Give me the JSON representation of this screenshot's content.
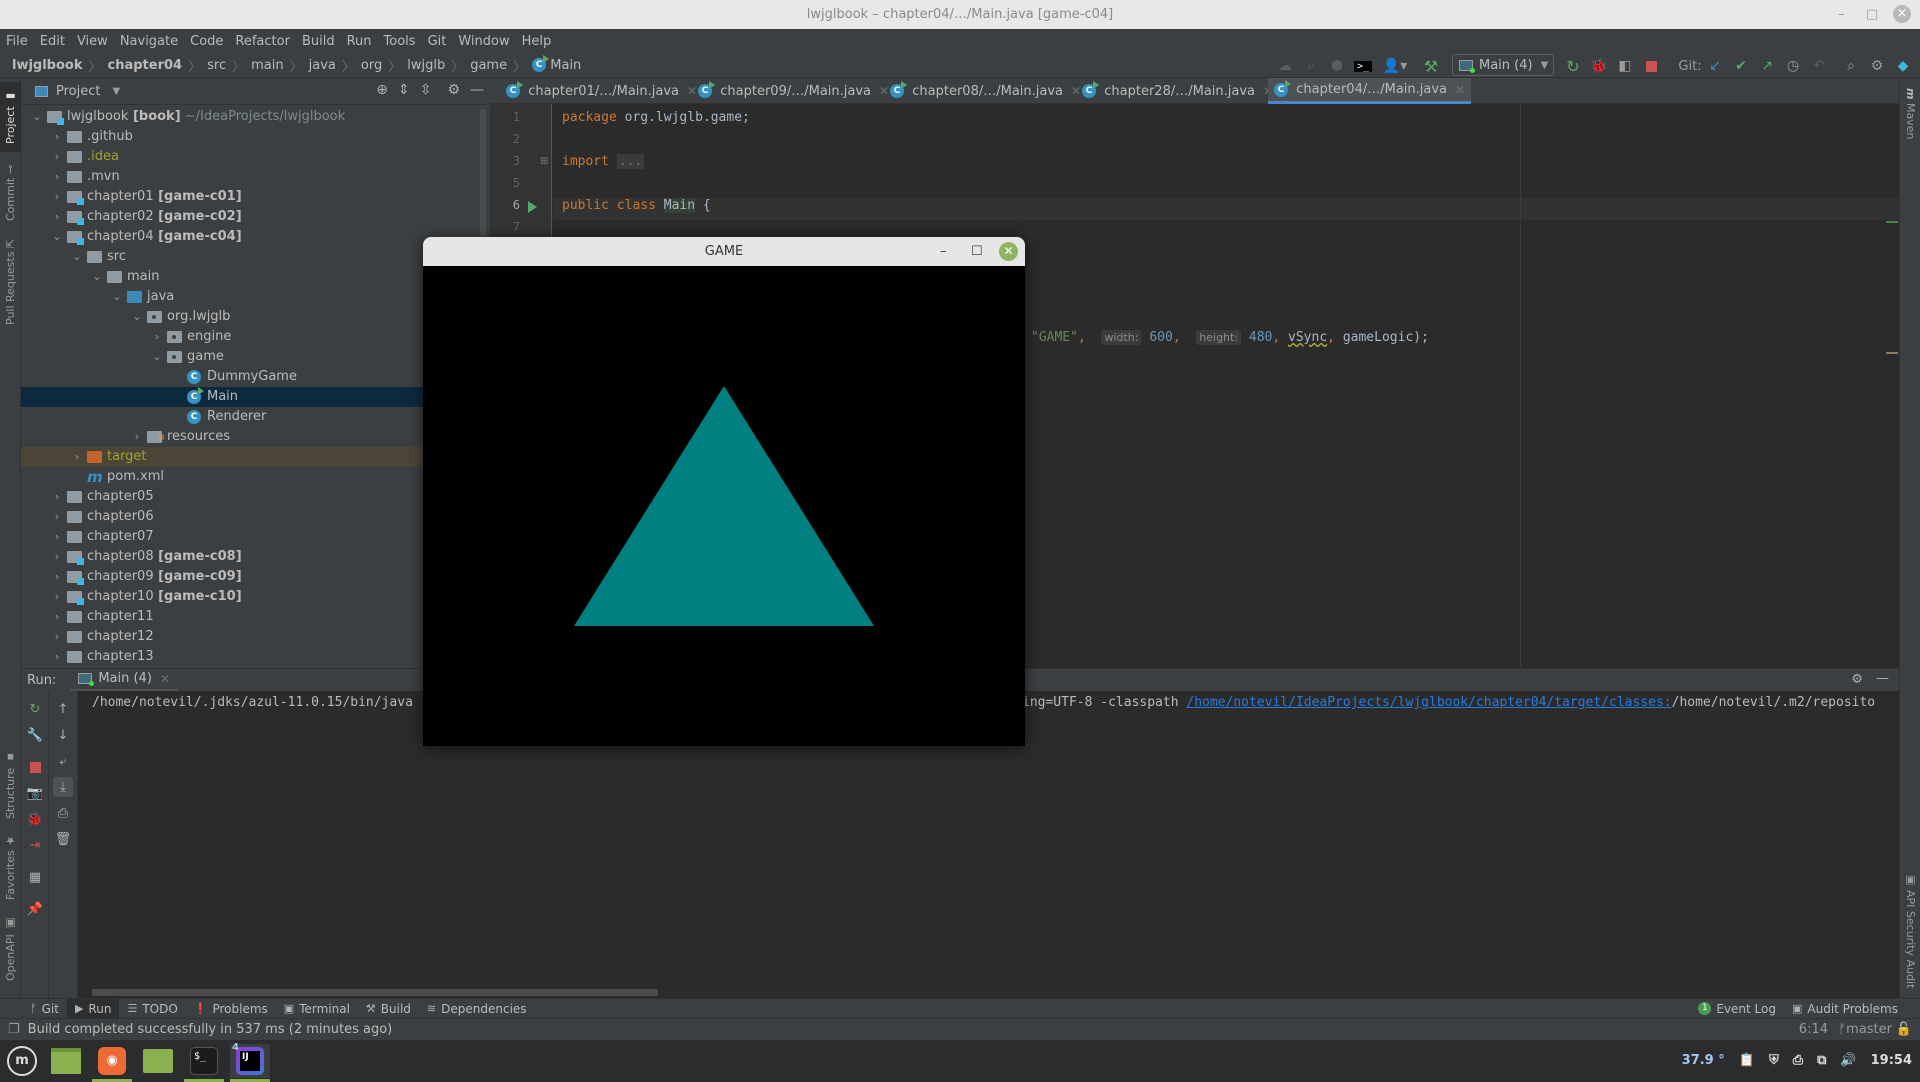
{
  "window": {
    "title": "lwjglbook – chapter04/…/Main.java [game-c04]",
    "minimize": "–",
    "maximize": "□",
    "close": "×"
  },
  "menu": [
    "File",
    "Edit",
    "View",
    "Navigate",
    "Code",
    "Refactor",
    "Build",
    "Run",
    "Tools",
    "Git",
    "Window",
    "Help"
  ],
  "breadcrumb": [
    "lwjglbook",
    "chapter04",
    "src",
    "main",
    "java",
    "org",
    "lwjglb",
    "game",
    "Main"
  ],
  "toolbar": {
    "run_config": "Main (4)",
    "git_label": "Git:",
    "icons": [
      "cloud-icon",
      "search-project-icon",
      "hexagon-icon",
      "terminal-icon",
      "user-dropdown-icon",
      "build-hammer-icon",
      "rerun-icon",
      "debug-icon",
      "coverage-icon",
      "stop-icon",
      "git-update-icon",
      "git-commit-icon",
      "git-push-icon",
      "history-icon",
      "rollback-icon",
      "search-icon",
      "settings-icon",
      "jetbrains-icon"
    ]
  },
  "left_strip": [
    "Project",
    "Commit",
    "Pull Requests",
    "Structure",
    "Favorites",
    "OpenAPI"
  ],
  "right_strip": [
    "Maven",
    "API Security Audit"
  ],
  "project": {
    "header": "Project",
    "tree": [
      {
        "label": "lwjglbook",
        "tag": "[book]",
        "path": "~/IdeaProjects/lwjglbook",
        "depth": 0,
        "expanded": true,
        "icon": "module"
      },
      {
        "label": ".github",
        "depth": 1,
        "expanded": false,
        "icon": "folder"
      },
      {
        "label": ".idea",
        "depth": 1,
        "expanded": false,
        "icon": "folder",
        "style": "olive"
      },
      {
        "label": ".mvn",
        "depth": 1,
        "expanded": false,
        "icon": "folder"
      },
      {
        "label": "chapter01",
        "tag": "[game-c01]",
        "depth": 1,
        "expanded": false,
        "icon": "module"
      },
      {
        "label": "chapter02",
        "tag": "[game-c02]",
        "depth": 1,
        "expanded": false,
        "icon": "module"
      },
      {
        "label": "chapter04",
        "tag": "[game-c04]",
        "depth": 1,
        "expanded": true,
        "icon": "module"
      },
      {
        "label": "src",
        "depth": 2,
        "expanded": true,
        "icon": "folder"
      },
      {
        "label": "main",
        "depth": 3,
        "expanded": true,
        "icon": "folder"
      },
      {
        "label": "java",
        "depth": 4,
        "expanded": true,
        "icon": "source"
      },
      {
        "label": "org.lwjglb",
        "depth": 5,
        "expanded": true,
        "icon": "package"
      },
      {
        "label": "engine",
        "depth": 6,
        "expanded": false,
        "icon": "package"
      },
      {
        "label": "game",
        "depth": 6,
        "expanded": true,
        "icon": "package"
      },
      {
        "label": "DummyGame",
        "depth": 7,
        "icon": "class"
      },
      {
        "label": "Main",
        "depth": 7,
        "icon": "class-run",
        "selected": true
      },
      {
        "label": "Renderer",
        "depth": 7,
        "icon": "class"
      },
      {
        "label": "resources",
        "depth": 5,
        "expanded": false,
        "icon": "resources"
      },
      {
        "label": "target",
        "depth": 2,
        "expanded": false,
        "icon": "excluded",
        "style": "olive",
        "excluded": true
      },
      {
        "label": "pom.xml",
        "depth": 2,
        "icon": "maven"
      },
      {
        "label": "chapter05",
        "depth": 1,
        "expanded": false,
        "icon": "folder"
      },
      {
        "label": "chapter06",
        "depth": 1,
        "expanded": false,
        "icon": "folder"
      },
      {
        "label": "chapter07",
        "depth": 1,
        "expanded": false,
        "icon": "folder"
      },
      {
        "label": "chapter08",
        "tag": "[game-c08]",
        "depth": 1,
        "expanded": false,
        "icon": "module"
      },
      {
        "label": "chapter09",
        "tag": "[game-c09]",
        "depth": 1,
        "expanded": false,
        "icon": "module"
      },
      {
        "label": "chapter10",
        "tag": "[game-c10]",
        "depth": 1,
        "expanded": false,
        "icon": "module"
      },
      {
        "label": "chapter11",
        "depth": 1,
        "expanded": false,
        "icon": "folder"
      },
      {
        "label": "chapter12",
        "depth": 1,
        "expanded": false,
        "icon": "folder"
      },
      {
        "label": "chapter13",
        "depth": 1,
        "expanded": false,
        "icon": "folder"
      }
    ]
  },
  "editor": {
    "tabs": [
      {
        "label": "chapter01/…/Main.java",
        "active": false
      },
      {
        "label": "chapter09/…/Main.java",
        "active": false
      },
      {
        "label": "chapter08/…/Main.java",
        "active": false
      },
      {
        "label": "chapter28/…/Main.java",
        "active": false
      },
      {
        "label": "chapter04/…/Main.java",
        "active": true
      }
    ],
    "line_numbers": [
      "1",
      "2",
      "3",
      "5",
      "6",
      "7"
    ],
    "lines": {
      "l1_kw": "package",
      "l1_rest": " org.lwjglb.game;",
      "l3_kw": "import",
      "l3_fold": "...",
      "l6_kw": "public class",
      "l6_name": "Main",
      "l6_rest": " {",
      "visible_str": "\"GAME\"",
      "hint_width": "width:",
      "val_width": "600",
      "hint_height": "height:",
      "val_height": "480",
      "arg_vsync": "vSync",
      "arg_tail": "gameLogic);"
    },
    "inspections": {
      "warnings": "1",
      "weak_warnings": "1"
    }
  },
  "game_window": {
    "title": "GAME",
    "background": "#000000",
    "triangle_color": "#008080"
  },
  "run_panel": {
    "label": "Run:",
    "tab": "Main (4)",
    "console_left": "/home/notevil/.jdks/azul-11.0.15/bin/java",
    "console_mid": "ing=UTF-8 -classpath ",
    "console_link": "/home/notevil/IdeaProjects/lwjglbook/chapter04/target/classes:",
    "console_right": "/home/notevil/.m2/reposito"
  },
  "tool_windows": [
    {
      "label": "Git",
      "icon": "git-branch-icon"
    },
    {
      "label": "Run",
      "icon": "run-icon",
      "active": true
    },
    {
      "label": "TODO",
      "icon": "list-icon"
    },
    {
      "label": "Problems",
      "icon": "problems-icon"
    },
    {
      "label": "Terminal",
      "icon": "terminal-icon"
    },
    {
      "label": "Build",
      "icon": "hammer-icon"
    },
    {
      "label": "Dependencies",
      "icon": "layers-icon"
    }
  ],
  "tool_windows_right": [
    {
      "label": "Event Log",
      "badge": "1"
    },
    {
      "label": "Audit Problems"
    }
  ],
  "status": {
    "message": "Build completed successfully in 537 ms (2 minutes ago)",
    "position": "6:14",
    "branch": "master"
  },
  "taskbar": {
    "apps": [
      "mint-menu",
      "show-desktop",
      "firefox",
      "files",
      "terminal",
      "intellij-idea"
    ],
    "idea_badge": "4",
    "temperature": "37.9 °",
    "clock": "19:54"
  }
}
